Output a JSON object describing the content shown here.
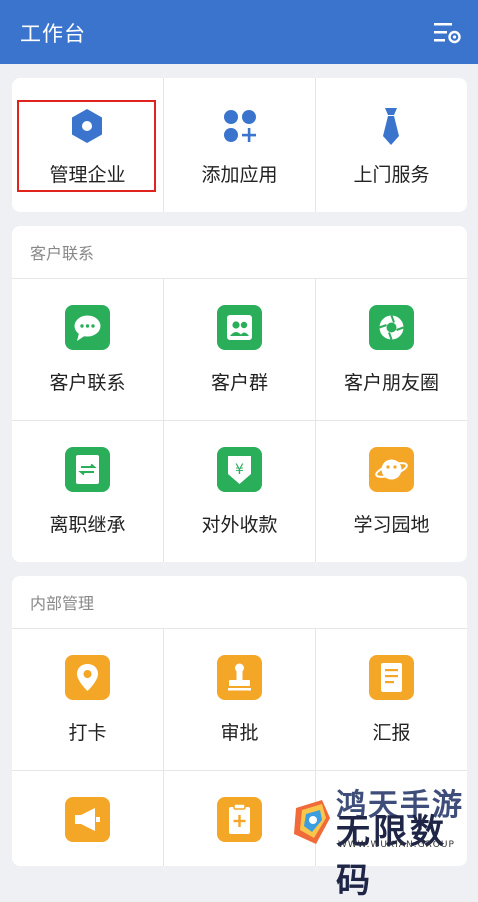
{
  "header": {
    "title": "工作台",
    "settings_icon": "list-settings-icon"
  },
  "top_actions": [
    {
      "label": "管理企业",
      "icon": "hexagon-icon"
    },
    {
      "label": "添加应用",
      "icon": "apps-add-icon"
    },
    {
      "label": "上门服务",
      "icon": "necktie-icon"
    }
  ],
  "customer_section": {
    "title": "客户联系",
    "items": [
      {
        "label": "客户联系",
        "icon": "chat-bubble-icon"
      },
      {
        "label": "客户群",
        "icon": "group-icon"
      },
      {
        "label": "客户朋友圈",
        "icon": "aperture-icon"
      },
      {
        "label": "离职继承",
        "icon": "transfer-document-icon"
      },
      {
        "label": "对外收款",
        "icon": "yuan-shield-icon"
      },
      {
        "label": "学习园地",
        "icon": "planet-icon"
      }
    ]
  },
  "internal_section": {
    "title": "内部管理",
    "items": [
      {
        "label": "打卡",
        "icon": "location-pin-icon"
      },
      {
        "label": "审批",
        "icon": "stamp-icon"
      },
      {
        "label": "汇报",
        "icon": "report-document-icon"
      },
      {
        "label": "",
        "icon": "megaphone-icon"
      },
      {
        "label": "",
        "icon": "clipboard-plus-icon"
      }
    ]
  },
  "watermark": {
    "top": "鸿天手游",
    "main": "无限数码",
    "sub": "WWW.WUXIAN.GROUP"
  },
  "colors": {
    "header": "#3b74cd",
    "accent_blue": "#3b74cd",
    "green": "#2aae5a",
    "orange": "#f4a626",
    "highlight": "#e0231c"
  }
}
